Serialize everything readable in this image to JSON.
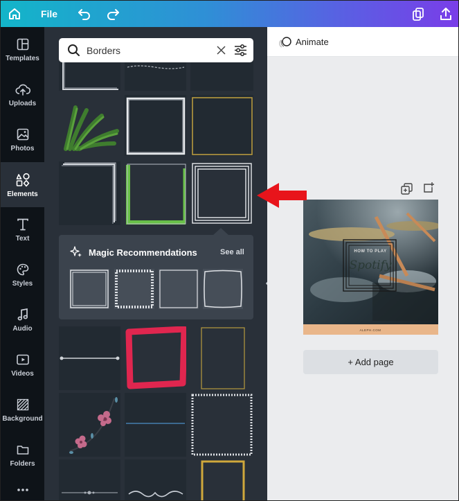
{
  "topbar": {
    "file_label": "File"
  },
  "sidebar": {
    "items": [
      {
        "label": "Templates",
        "icon": "templates-icon"
      },
      {
        "label": "Uploads",
        "icon": "upload-icon"
      },
      {
        "label": "Photos",
        "icon": "photo-icon"
      },
      {
        "label": "Elements",
        "icon": "elements-icon",
        "active": true
      },
      {
        "label": "Text",
        "icon": "text-icon"
      },
      {
        "label": "Styles",
        "icon": "palette-icon"
      },
      {
        "label": "Audio",
        "icon": "music-note-icon"
      },
      {
        "label": "Videos",
        "icon": "video-icon"
      },
      {
        "label": "Background",
        "icon": "background-icon"
      },
      {
        "label": "Folders",
        "icon": "folder-icon"
      }
    ]
  },
  "search": {
    "value": "Borders"
  },
  "magic": {
    "title": "Magic Recommendations",
    "see_all": "See all"
  },
  "editor": {
    "animate_label": "Animate",
    "add_page_label": "+ Add page",
    "design": {
      "line1": "HOW TO PLAY",
      "line2": "Spotify",
      "footer": "ALEPH.COM"
    }
  },
  "colors": {
    "accent_arrow": "#e8141b",
    "panel_bg": "#293039",
    "rail_bg": "#0e1318"
  }
}
